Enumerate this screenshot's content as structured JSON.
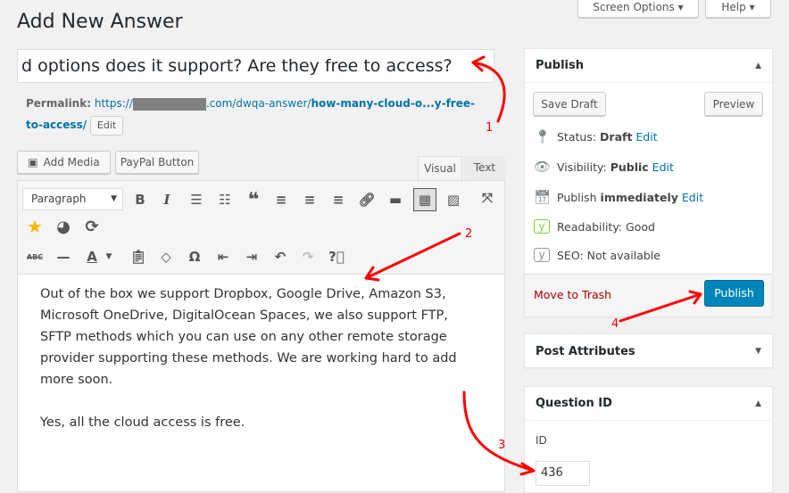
{
  "page_title": "Add New Answer",
  "screen_options": "Screen Options",
  "help": "Help",
  "title_value": "d options does it support? Are they free to access?",
  "permalink": {
    "label": "Permalink:",
    "prefix": "https://",
    "domain_suffix": ".com/dwqa-answer/",
    "slug": "how-many-cloud-o...y-free-to-access/",
    "edit": "Edit"
  },
  "media": {
    "add_media": "Add Media",
    "paypal": "PayPal Button"
  },
  "tabs": {
    "visual": "Visual",
    "text": "Text"
  },
  "format_select": "Paragraph",
  "content": [
    "Out of the box we support Dropbox, Google Drive, Amazon S3, Microsoft OneDrive, DigitalOcean Spaces, we also support FTP, SFTP methods which you can use on any other remote storage provider supporting these methods. We are working hard to add more soon.",
    "Yes, all the cloud access is free."
  ],
  "publish": {
    "title": "Publish",
    "save_draft": "Save Draft",
    "preview": "Preview",
    "status_label": "Status:",
    "status": "Draft",
    "visibility_label": "Visibility:",
    "visibility": "Public",
    "publish_label": "Publish",
    "publish_when": "immediately",
    "edit": "Edit",
    "readability_label": "Readability:",
    "readability": "Good",
    "seo_label": "SEO:",
    "seo": "Not available",
    "trash": "Move to Trash",
    "publish_button": "Publish"
  },
  "post_attributes": {
    "title": "Post Attributes"
  },
  "question_id": {
    "title": "Question ID",
    "label": "ID",
    "value": "436"
  },
  "annotations": [
    "1",
    "2",
    "3",
    "4"
  ],
  "colors": {
    "accent": "#0085ba",
    "trash": "#a00",
    "annotation": "#ff0000",
    "readability": "#7ad03a"
  }
}
